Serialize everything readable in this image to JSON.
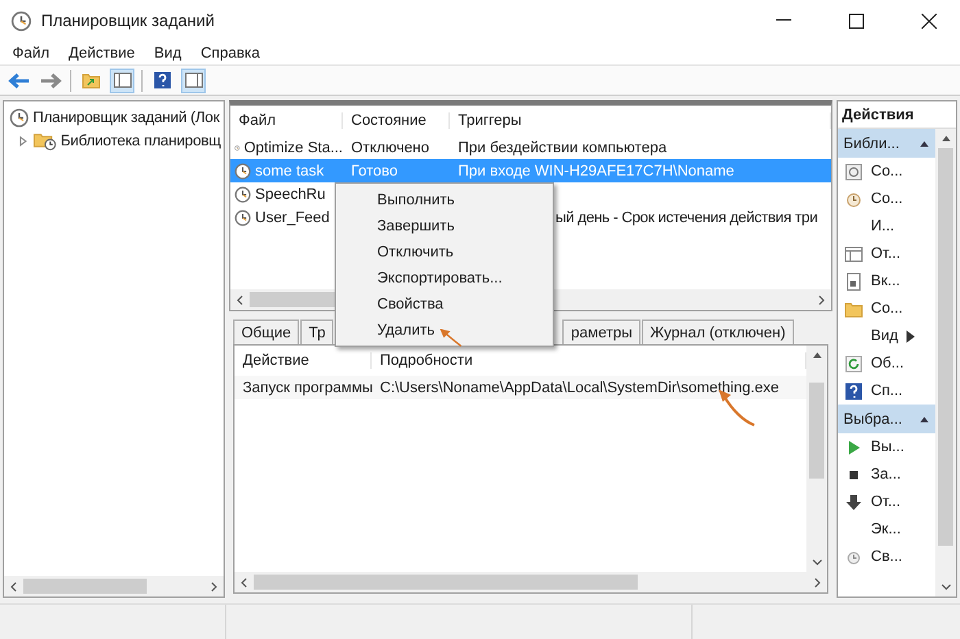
{
  "window": {
    "title": "Планировщик заданий"
  },
  "menu": [
    "Файл",
    "Действие",
    "Вид",
    "Справка"
  ],
  "tree": {
    "label": "Планировщик заданий (Лок",
    "expanded": true,
    "children": [
      {
        "label": "Библиотека планировщ",
        "expanded": false
      }
    ]
  },
  "tasks": {
    "columns": [
      "Файл",
      "Состояние",
      "Триггеры"
    ],
    "rows": [
      {
        "file": "Optimize Sta...",
        "status": "Отключено",
        "trigger": "При бездействии компьютера",
        "selected": false
      },
      {
        "file": "some task",
        "status": "Готово",
        "trigger": "При входе WIN-H29AFE17C7H\\Noname",
        "selected": true
      },
      {
        "file": "SpeechRu",
        "selected": false
      },
      {
        "file": "User_Feed",
        "trigger": "ый день - Срок истечения действия три",
        "trigger_covered": true,
        "selected": false
      }
    ]
  },
  "tabs": [
    {
      "label": "Общие",
      "selected": false
    },
    {
      "label": "Тр",
      "selected": false
    },
    {
      "label": "раметры",
      "covered": true,
      "selected": false
    },
    {
      "label": "Журнал (отключен)",
      "selected": false
    }
  ],
  "details": {
    "columns": [
      "Действие",
      "Подробности"
    ],
    "rows": [
      [
        "Запуск программы",
        "C:\\Users\\Noname\\AppData\\Local\\SystemDir\\something.exe"
      ]
    ]
  },
  "context_menu": [
    "Выполнить",
    "Завершить",
    "Отключить",
    "Экспортировать...",
    "Свойства",
    "Удалить"
  ],
  "actions": {
    "title": "Действия",
    "sections": [
      {
        "title": "Библи...",
        "expanded": true,
        "items": [
          {
            "label": "Со...",
            "kind": "plain"
          },
          {
            "label": "Со...",
            "kind": "plain"
          },
          {
            "label": "И...",
            "kind": "plain"
          },
          {
            "label": "От...",
            "kind": "plain"
          },
          {
            "label": "Вк...",
            "kind": "plain"
          },
          {
            "label": "Со...",
            "kind": "plain"
          },
          {
            "label": "Вид",
            "kind": "submenu"
          },
          {
            "label": "Об...",
            "kind": "plain"
          },
          {
            "label": "Сп...",
            "kind": "plain"
          }
        ]
      },
      {
        "title": "Выбра...",
        "expanded": true,
        "items": [
          {
            "label": "Вы...",
            "kind": "plain"
          },
          {
            "label": "За...",
            "kind": "plain"
          },
          {
            "label": "От...",
            "kind": "plain"
          },
          {
            "label": "Эк...",
            "kind": "plain"
          },
          {
            "label": "Св...",
            "kind": "plain"
          }
        ]
      }
    ]
  }
}
